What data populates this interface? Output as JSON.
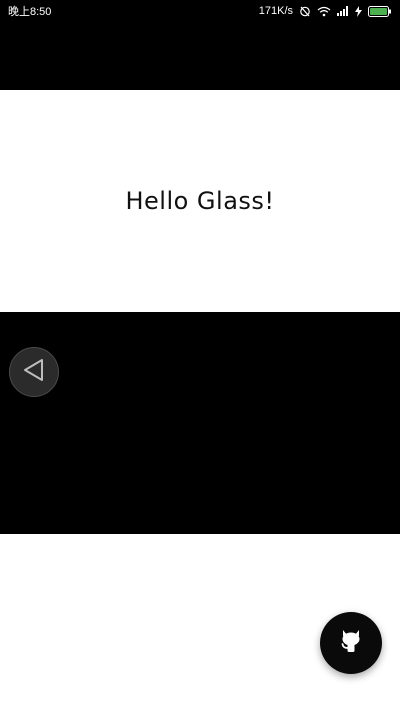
{
  "status_bar": {
    "time": "晚上8:50",
    "network_speed": "171K/s",
    "icons": [
      "alarm-off-icon",
      "wifi-icon",
      "signal-icon",
      "charging-icon",
      "battery-icon"
    ],
    "battery_color": "#4caf50"
  },
  "card": {
    "title": "Hello Glass!"
  },
  "buttons": {
    "back": "back-triangle-icon",
    "fab": "github-octocat-icon"
  },
  "colors": {
    "band": "#000000",
    "card": "#ffffff",
    "fab": "#0a0a0a"
  }
}
